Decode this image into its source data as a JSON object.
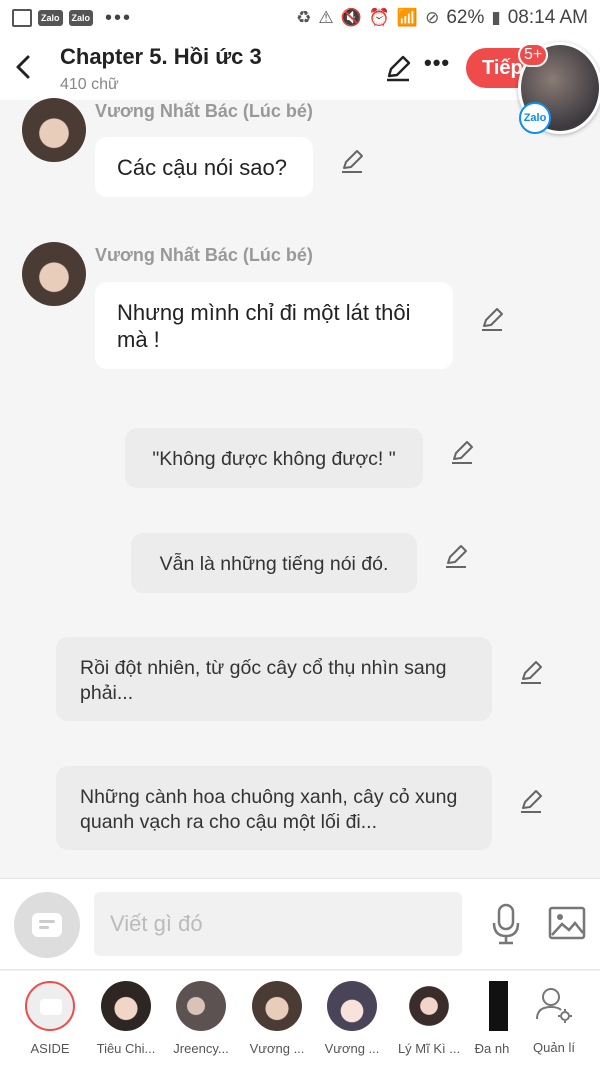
{
  "status_bar": {
    "app_labels": [
      "Zalo",
      "Zalo"
    ],
    "battery": "62%",
    "time": "08:14 AM"
  },
  "header": {
    "title": "Chapter 5. Hồi ức 3",
    "subtitle": "410 chữ",
    "next_label": "Tiếp",
    "badge": "5+",
    "zalo_label": "Zalo"
  },
  "messages": [
    {
      "kind": "character",
      "name": "Vương Nhất Bác (Lúc bé)",
      "text": "Các cậu nói sao?"
    },
    {
      "kind": "character",
      "name": "Vương Nhất Bác (Lúc bé)",
      "text": "Nhưng mình chỉ đi một lát thôi mà !"
    },
    {
      "kind": "narration",
      "text": "\"Không được không được! \""
    },
    {
      "kind": "narration",
      "text": "Vẫn là những tiếng nói đó."
    },
    {
      "kind": "narration",
      "text": "Rồi đột nhiên, từ gốc cây cổ thụ nhìn sang phải..."
    },
    {
      "kind": "narration",
      "text": "Những cành hoa chuông xanh, cây cỏ xung quanh vạch ra cho cậu một lối đi..."
    }
  ],
  "composer": {
    "placeholder": "Viết gì đó"
  },
  "characters": [
    {
      "label": "ASIDE"
    },
    {
      "label": "Tiêu Chi..."
    },
    {
      "label": "Jreency..."
    },
    {
      "label": "Vương ..."
    },
    {
      "label": "Vương ..."
    },
    {
      "label": "Lý Mĩ Kì ..."
    },
    {
      "label": "Đa nh"
    },
    {
      "label": "Quản lí"
    }
  ],
  "colors": {
    "accent": "#f04b4b",
    "background": "#f5f5f5",
    "narration_bubble": "#ececec"
  }
}
